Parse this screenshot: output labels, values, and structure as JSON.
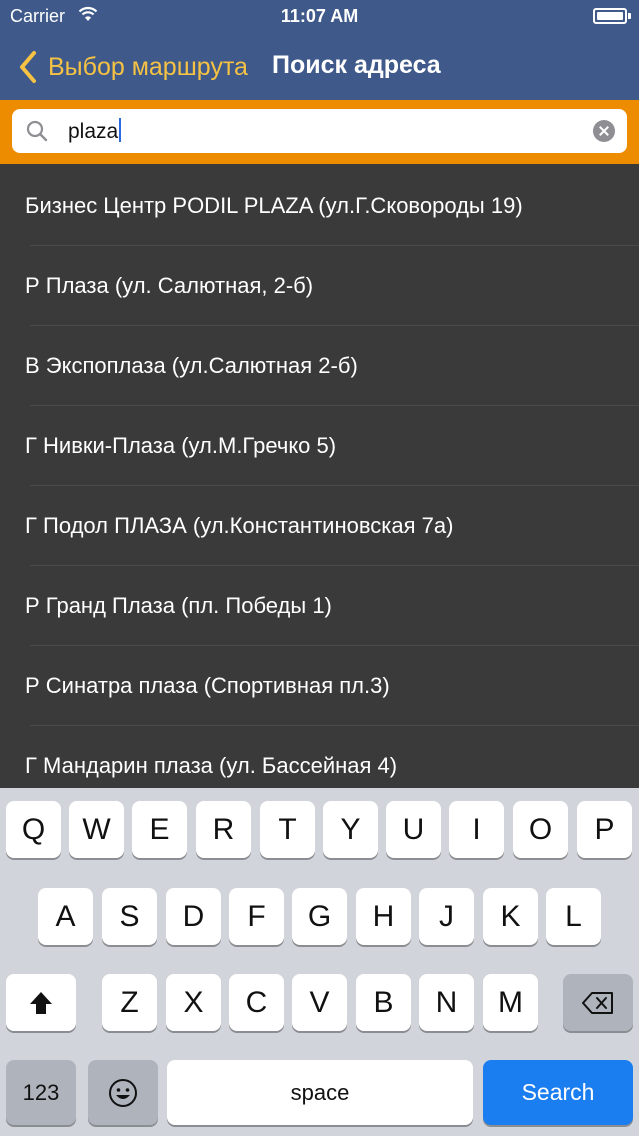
{
  "status_bar": {
    "carrier": "Carrier",
    "time": "11:07 AM"
  },
  "nav": {
    "back_label": "Выбор маршрута",
    "title": "Поиск адреса"
  },
  "search": {
    "value": "plaza"
  },
  "results": [
    "Бизнес Центр PODIL PLAZA (ул.Г.Сковороды 19)",
    "Р Плаза (ул. Салютная, 2-б)",
    "В Экспоплаза (ул.Салютная 2-б)",
    "Г Нивки-Плаза (ул.М.Гречко 5)",
    "Г Подол ПЛАЗА (ул.Константиновская 7а)",
    "Р Гранд Плаза (пл. Победы 1)",
    "Р Синатра плаза (Спортивная пл.3)",
    "Г Мандарин плаза (ул. Бассейная 4)"
  ],
  "keyboard": {
    "row1": [
      "Q",
      "W",
      "E",
      "R",
      "T",
      "Y",
      "U",
      "I",
      "O",
      "P"
    ],
    "row2": [
      "A",
      "S",
      "D",
      "F",
      "G",
      "H",
      "J",
      "K",
      "L"
    ],
    "row3": [
      "Z",
      "X",
      "C",
      "V",
      "B",
      "N",
      "M"
    ],
    "numbers_key": "123",
    "space_key": "space",
    "search_key": "Search"
  },
  "colors": {
    "nav_bar": "#3f5a8a",
    "accent_gold": "#f5c243",
    "search_bar_orange": "#ee8c00",
    "list_background": "#3a3a3a",
    "search_key_blue": "#1a7df0"
  },
  "icons": {
    "wifi": "wifi-icon",
    "battery": "battery-icon",
    "back": "chevron-left-icon",
    "search": "magnifier-icon",
    "clear": "clear-x-icon",
    "shift": "shift-arrow-icon",
    "delete": "backspace-icon",
    "emoji": "emoji-icon"
  }
}
